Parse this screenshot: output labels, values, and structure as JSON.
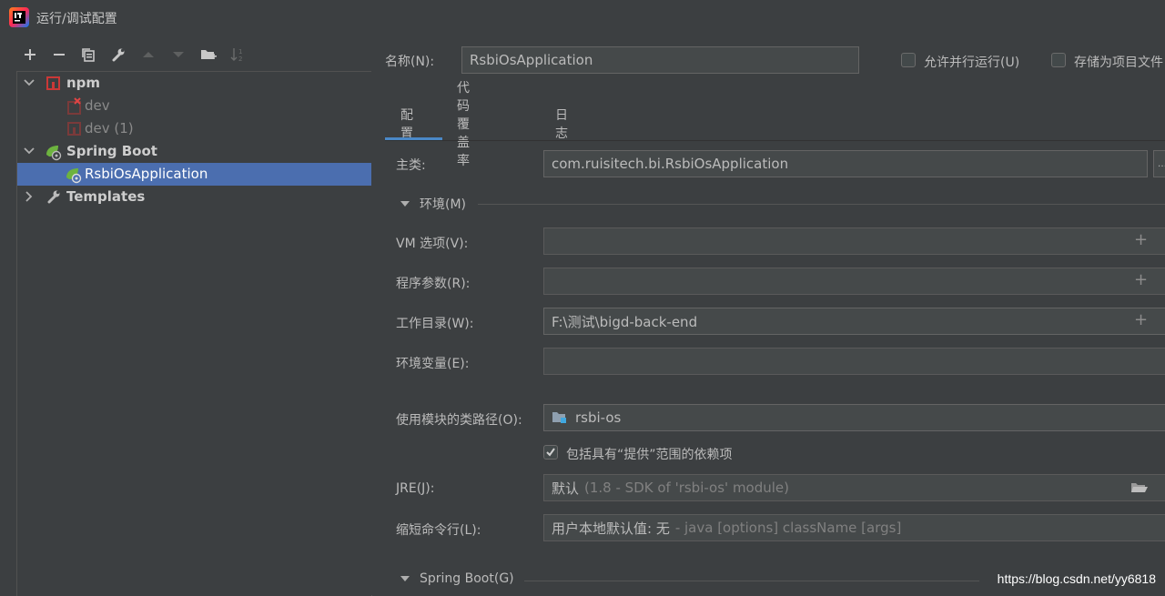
{
  "window": {
    "title": "运行/调试配置"
  },
  "tree": {
    "items": [
      {
        "label": "npm"
      },
      {
        "label": "dev"
      },
      {
        "label": "dev (1)"
      },
      {
        "label": "Spring Boot"
      },
      {
        "label": "RsbiOsApplication"
      },
      {
        "label": "Templates"
      }
    ]
  },
  "header": {
    "name_label": "名称(N):",
    "name_value": "RsbiOsApplication",
    "allow_parallel": "允许并行运行(U)",
    "store_as_file": "存储为项目文件"
  },
  "tabs": [
    {
      "label": "配置"
    },
    {
      "label": "代码覆盖率"
    },
    {
      "label": "日志"
    }
  ],
  "form": {
    "main_class_label": "主类:",
    "main_class_value": "com.ruisitech.bi.RsbiOsApplication",
    "env_section": "环境(M)",
    "vm_label": "VM 选项(V):",
    "args_label": "程序参数(R):",
    "workdir_label": "工作目录(W):",
    "workdir_value": "F:\\测试\\bigd-back-end",
    "envvars_label": "环境变量(E):",
    "module_label": "使用模块的类路径(O):",
    "module_value": "rsbi-os",
    "include_provided": "包括具有“提供”范围的依赖项",
    "jre_label": "JRE(J):",
    "jre_value": "默认",
    "jre_hint": "(1.8 - SDK of 'rsbi-os' module)",
    "shorten_label": "缩短命令行(L):",
    "shorten_value": "用户本地默认值: 无",
    "shorten_hint": "- java [options] className [args]",
    "spring_section": "Spring Boot(G)"
  },
  "watermark": "https://blog.csdn.net/yy6818"
}
